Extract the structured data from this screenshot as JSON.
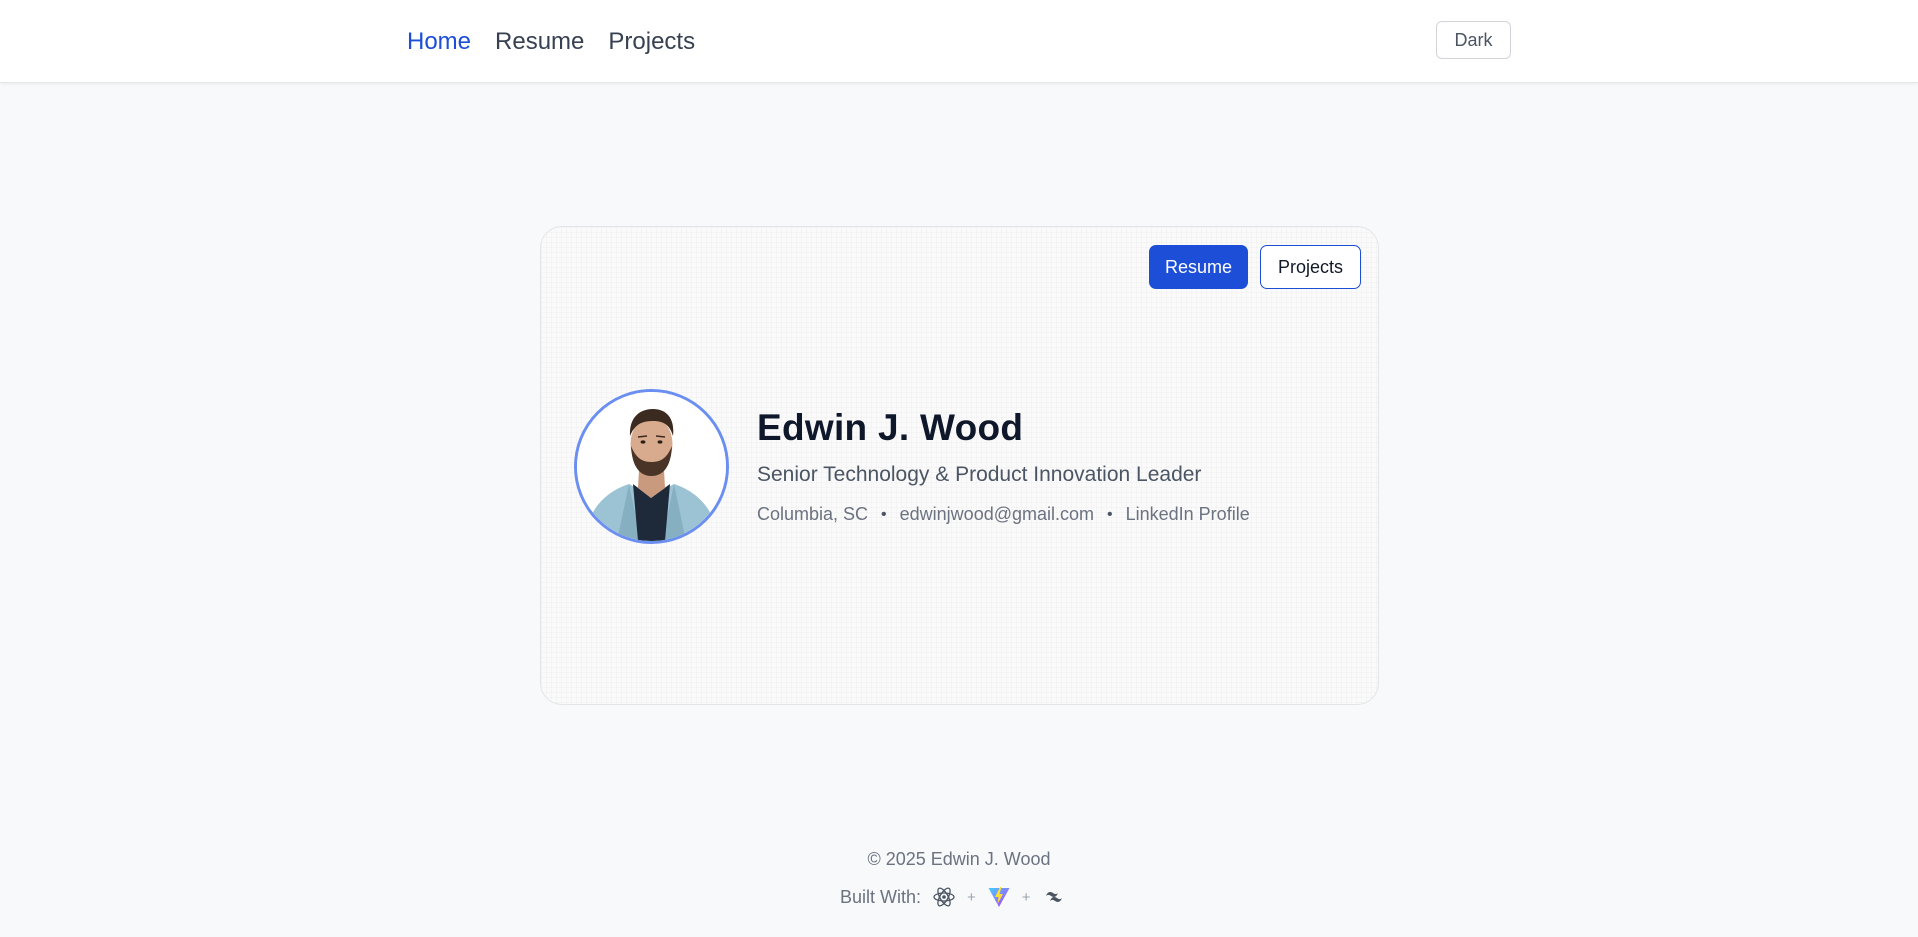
{
  "nav": {
    "items": [
      {
        "label": "Home",
        "active": true
      },
      {
        "label": "Resume",
        "active": false
      },
      {
        "label": "Projects",
        "active": false
      }
    ],
    "theme_toggle_label": "Dark"
  },
  "card": {
    "primary_button_label": "Resume",
    "secondary_button_label": "Projects",
    "name": "Edwin J. Wood",
    "title": "Senior Technology & Product Innovation Leader",
    "location": "Columbia, SC",
    "email": "edwinjwood@gmail.com",
    "linkedin_label": "LinkedIn Profile",
    "separator": "•",
    "avatar_icon": "profile-photo"
  },
  "footer": {
    "copyright": "© 2025 Edwin J. Wood",
    "built_with_label": "Built With:",
    "plus": "+",
    "tech_icons": [
      "react-icon",
      "vite-icon",
      "tailwind-icon"
    ]
  },
  "colors": {
    "accent": "#1d4ed8",
    "avatar_ring": "#6b8ff0",
    "background": "#f8f9fb",
    "heading": "#0f172a"
  }
}
